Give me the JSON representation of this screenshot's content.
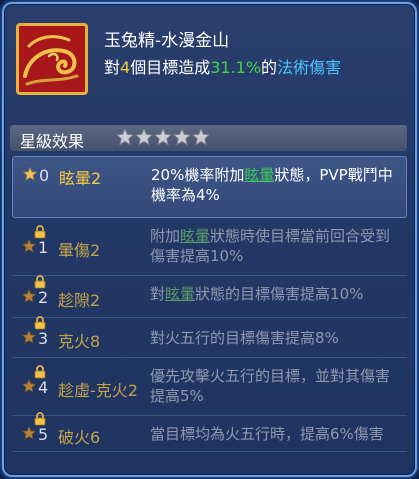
{
  "skill": {
    "name": "玉兔精-水漫金山",
    "desc_prefix": "對",
    "targets": "4",
    "desc_mid": "個目標造成",
    "damage_pct": "31.1%",
    "desc_of": "的",
    "damage_type": "法術傷害"
  },
  "section": {
    "title": "星級效果",
    "star_rating": 5
  },
  "effects": [
    {
      "level": "0",
      "name": "眩暈2",
      "locked": false,
      "text": [
        "20%機率附加",
        "眩暈",
        "狀態，PVP戰鬥中機率為4%"
      ]
    },
    {
      "level": "1",
      "name": "暈傷2",
      "locked": true,
      "text": [
        "附加",
        "眩暈",
        "狀態時使目標當前回合受到傷害提高10%"
      ]
    },
    {
      "level": "2",
      "name": "趁隙2",
      "locked": true,
      "text": [
        "對",
        "眩暈",
        "狀態的目標傷害提高10%"
      ]
    },
    {
      "level": "3",
      "name": "克火8",
      "locked": true,
      "text": [
        "對火五行的目標傷害提高8%",
        "",
        ""
      ]
    },
    {
      "level": "4",
      "name": "趁虛-克火2",
      "locked": true,
      "text": [
        "優先攻擊火五行的目標，並對其傷害提高5%",
        "",
        ""
      ]
    },
    {
      "level": "5",
      "name": "破火6",
      "locked": true,
      "text": [
        "當目標均為火五行時，提高6%傷害",
        "",
        ""
      ]
    }
  ],
  "colors": {
    "accent_yellow": "#f3c843",
    "accent_green": "#46d34a",
    "accent_cyan": "#4dc3ff",
    "frame_blue": "#6aa0e6"
  }
}
